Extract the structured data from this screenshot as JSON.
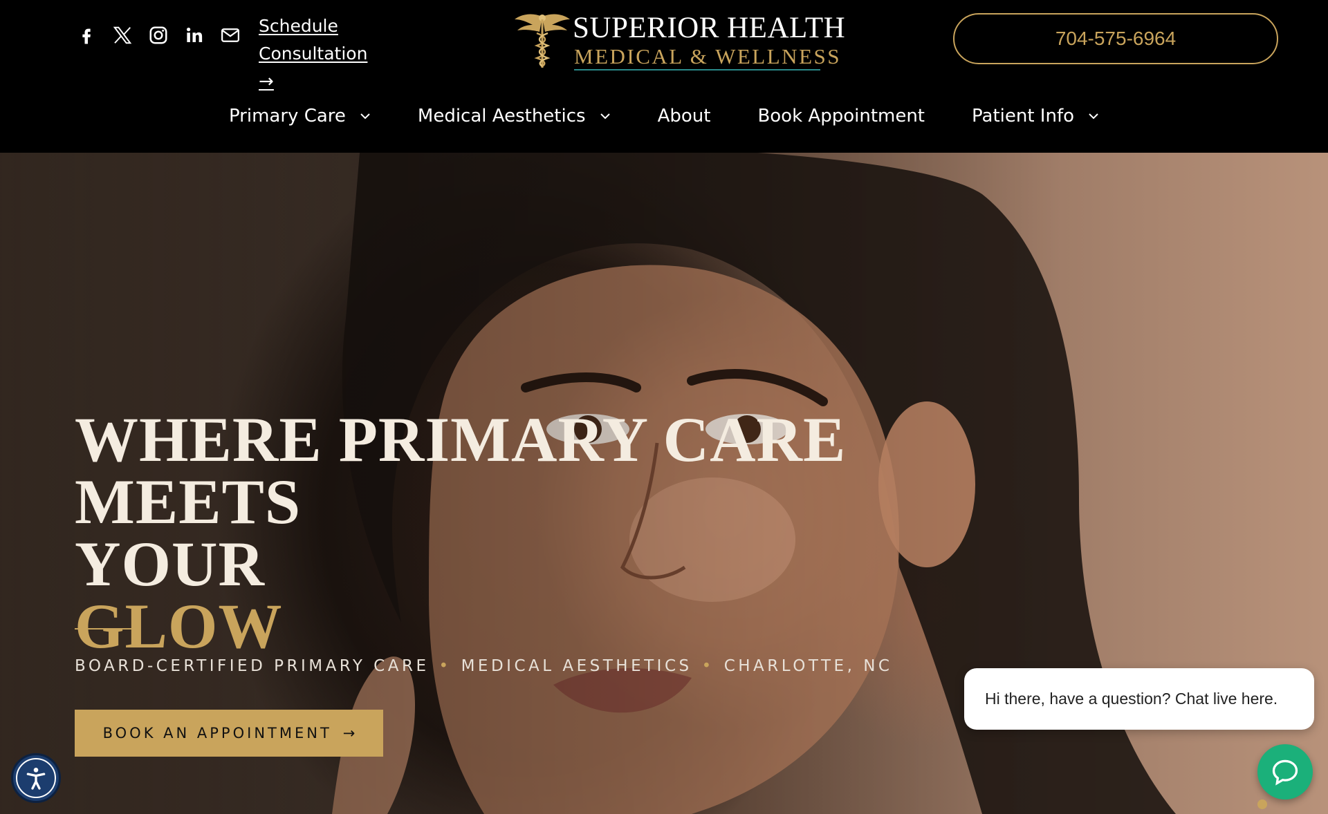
{
  "header": {
    "social_icons": [
      "facebook-icon",
      "x-icon",
      "instagram-icon",
      "linkedin-icon",
      "email-icon"
    ],
    "consult_label": "Schedule Consultation",
    "consult_arrow": "→",
    "logo_line1": "SUPERIOR HEALTH",
    "logo_line2": "MEDICAL & WELLNESS",
    "phone": "704-575-6964"
  },
  "nav": {
    "items": [
      {
        "label": "Primary Care",
        "dropdown": true
      },
      {
        "label": "Medical Aesthetics",
        "dropdown": true
      },
      {
        "label": "About",
        "dropdown": false
      },
      {
        "label": "Book Appointment",
        "dropdown": false
      },
      {
        "label": "Patient Info",
        "dropdown": true
      }
    ]
  },
  "hero": {
    "headline_line1": "WHERE PRIMARY CARE MEETS",
    "headline_line2": "YOUR",
    "headline_accent": "GLOW",
    "tagline_parts": [
      "BOARD-CERTIFIED PRIMARY CARE",
      "MEDICAL AESTHETICS",
      "CHARLOTTE, NC"
    ],
    "tagline_separator": "•",
    "cta_label": "BOOK AN APPOINTMENT",
    "cta_arrow": "→"
  },
  "chat": {
    "bubble_text": "Hi there, have a question? Chat live here."
  },
  "colors": {
    "gold": "#c9a45c",
    "black": "#000000",
    "chat_green": "#1bb07a",
    "a11y_blue": "#1c3d6e"
  }
}
